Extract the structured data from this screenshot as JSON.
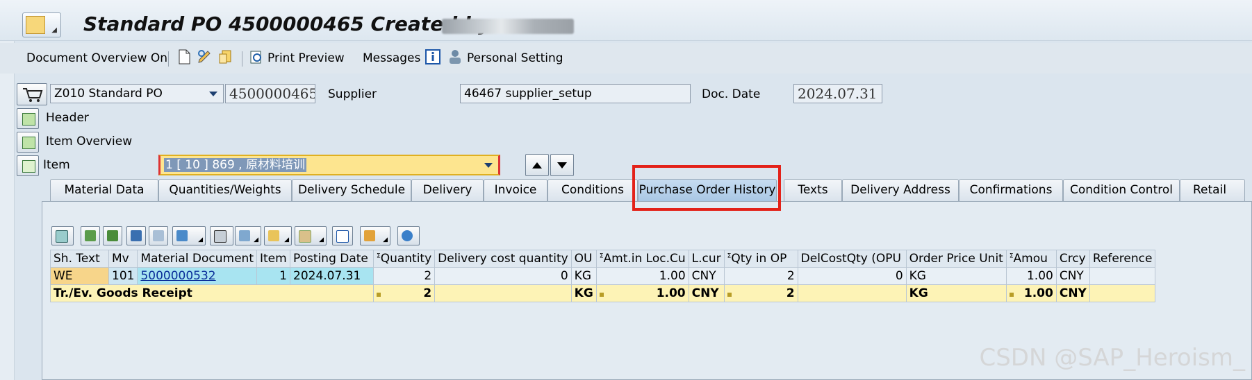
{
  "title": "Standard PO 4500000465 Created by",
  "toolbar": {
    "doc_overview": "Document Overview On",
    "print_preview": "Print Preview",
    "messages": "Messages",
    "personal_setting": "Personal Setting"
  },
  "header": {
    "doc_type": "Z010 Standard PO",
    "po_number": "4500000465",
    "supplier_label": "Supplier",
    "supplier_value": "46467 supplier_setup",
    "doc_date_label": "Doc. Date",
    "doc_date_value": "2024.07.31"
  },
  "sections": {
    "header": "Header",
    "item_overview": "Item Overview",
    "item": "Item"
  },
  "item_selector": "1 [ 10 ] 869 , 原材料培训",
  "tabs": [
    "Material Data",
    "Quantities/Weights",
    "Delivery Schedule",
    "Delivery",
    "Invoice",
    "Conditions",
    "Purchase Order History",
    "Texts",
    "Delivery Address",
    "Confirmations",
    "Condition Control",
    "Retail"
  ],
  "active_tab": "Purchase Order History",
  "grid": {
    "headers": [
      "Sh. Text",
      "Mv",
      "Material Document",
      "Item",
      "Posting Date",
      "Quantity",
      "Delivery cost quantity",
      "OU",
      "Amt.in Loc.Cu",
      "L.cur",
      "Qty in OP",
      "DelCostQty (OPU",
      "Order Price Unit",
      "Amou",
      "Crcy",
      "Reference"
    ],
    "sum_marker": "Σ",
    "row": {
      "sh_text": "WE",
      "mv": "101",
      "material_document": "5000000532",
      "item": "1",
      "posting_date": "2024.07.31",
      "quantity": "2",
      "delivery_cost_quantity": "0",
      "ou": "KG",
      "amt_loc": "1.00",
      "l_cur": "CNY",
      "qty_op": "2",
      "del_cost_qty_opu": "0",
      "order_price_unit": "KG",
      "amount": "1.00",
      "crcy": "CNY",
      "reference": ""
    },
    "total": {
      "label": "Tr./Ev. Goods Receipt",
      "quantity": "2",
      "ou": "KG",
      "amt_loc": "1.00",
      "l_cur": "CNY",
      "qty_op": "2",
      "order_price_unit": "KG",
      "amount": "1.00",
      "crcy": "CNY"
    }
  },
  "watermark": "CSDN @SAP_Heroism_",
  "colors": {
    "highlight": "#e32219",
    "active_tab": "#b3cee8",
    "total_row": "#fdf3b6"
  }
}
